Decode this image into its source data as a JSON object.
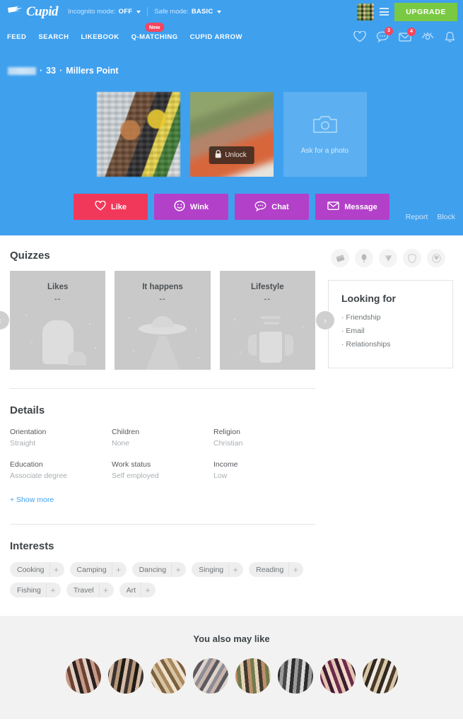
{
  "topbar": {
    "logo_text": "Cupid",
    "incognito_label": "Incognito mode:",
    "incognito_value": "OFF",
    "safe_label": "Safe mode:",
    "safe_value": "BASIC",
    "upgrade_label": "UPGRADE"
  },
  "nav": {
    "links": [
      {
        "label": "FEED",
        "badge": ""
      },
      {
        "label": "SEARCH",
        "badge": ""
      },
      {
        "label": "LIKEBOOK",
        "badge": ""
      },
      {
        "label": "Q-MATCHING",
        "badge": "New"
      },
      {
        "label": "CUPID ARROW",
        "badge": ""
      }
    ],
    "icons": [
      {
        "name": "heart-icon",
        "badge": ""
      },
      {
        "name": "chat-icon",
        "badge": "3"
      },
      {
        "name": "envelope-icon",
        "badge": "4"
      },
      {
        "name": "eye-icon",
        "badge": ""
      },
      {
        "name": "bell-icon",
        "badge": ""
      }
    ]
  },
  "profile": {
    "name": "",
    "age": "33",
    "location": "Millers Point",
    "separator": "·",
    "unlock_label": "Unlock",
    "ask_photo_label": "Ask for a photo",
    "actions": [
      {
        "label": "Like",
        "icon": "heart-icon",
        "color": "#f2385a"
      },
      {
        "label": "Wink",
        "icon": "wink-face-icon",
        "color": "#b340c9"
      },
      {
        "label": "Chat",
        "icon": "chat-bubble-icon",
        "color": "#b340c9"
      },
      {
        "label": "Message",
        "icon": "envelope-icon",
        "color": "#b340c9"
      }
    ],
    "report_label": "Report",
    "block_label": "Block"
  },
  "quizzes": {
    "title": "Quizzes",
    "cards": [
      {
        "title": "Likes",
        "score": "--"
      },
      {
        "title": "It happens",
        "score": "--"
      },
      {
        "title": "Lifestyle",
        "score": "--"
      }
    ],
    "prev_label": "‹",
    "next_label": "›"
  },
  "details": {
    "title": "Details",
    "items": [
      {
        "label": "Orientation",
        "value": "Straight"
      },
      {
        "label": "Children",
        "value": "None"
      },
      {
        "label": "Religion",
        "value": "Christian"
      },
      {
        "label": "Education",
        "value": "Associate degree"
      },
      {
        "label": "Work status",
        "value": "Self employed"
      },
      {
        "label": "Income",
        "value": "Low"
      }
    ],
    "show_more_label": "+ Show more"
  },
  "interests": {
    "title": "Interests",
    "tags": [
      "Cooking",
      "Camping",
      "Dancing",
      "Singing",
      "Reading",
      "Fishing",
      "Travel",
      "Art"
    ],
    "add_label": "+"
  },
  "gifts": [
    {
      "name": "chocolate-bar-icon"
    },
    {
      "name": "ice-cream-icon"
    },
    {
      "name": "diamond-icon"
    },
    {
      "name": "shield-icon"
    },
    {
      "name": "badge-icon"
    }
  ],
  "looking_for": {
    "title": "Looking for",
    "items": [
      "Friendship",
      "Email",
      "Relationships"
    ],
    "bullet": "·"
  },
  "footer": {
    "title": "You also may like",
    "avatar_count": 8
  },
  "colors": {
    "brand_blue": "#3fa0ee",
    "upgrade_green": "#7ac943",
    "like_pink": "#f2385a",
    "action_purple": "#b340c9",
    "badge_red": "#f5455f",
    "link_blue": "#3fa0ee"
  }
}
